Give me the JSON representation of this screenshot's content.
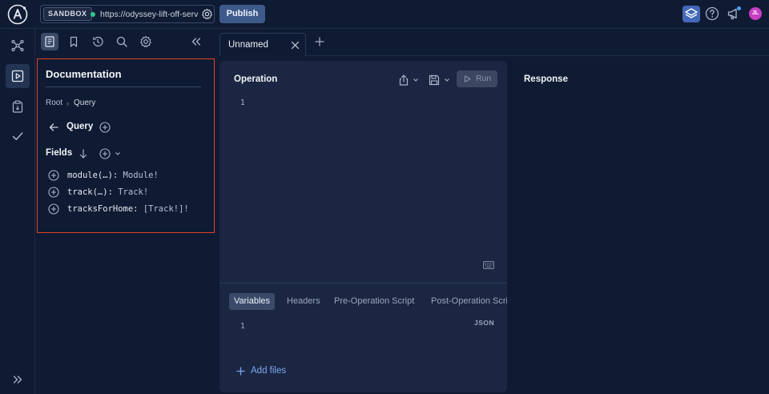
{
  "topbar": {
    "sandbox_badge": "SANDBOX",
    "endpoint_url": "https://odyssey-lift-off-server",
    "publish_label": "Publish",
    "avatar_initials": "JL",
    "status_color": "#34c48a",
    "accent_color": "#4368b8"
  },
  "rail": {
    "items": [
      "schema-graph-icon",
      "explorer-play-icon",
      "checks-list-icon",
      "checkmark-icon"
    ],
    "footer": "expand-icon"
  },
  "sidebar": {
    "toolbar_icons": [
      "documentation-icon",
      "bookmark-icon",
      "history-icon",
      "search-icon",
      "settings-icon",
      "collapse-icon"
    ]
  },
  "documentation": {
    "title": "Documentation",
    "breadcrumb": {
      "root": "Root",
      "separator": "›",
      "current": "Query"
    },
    "type_name": "Query",
    "fields_heading": "Fields",
    "fields": [
      {
        "name": "module(…):",
        "type": "Module!"
      },
      {
        "name": "track(…):",
        "type": "Track!"
      },
      {
        "name": "tracksForHome:",
        "type": "[Track!]!"
      }
    ]
  },
  "tabs": [
    {
      "label": "Unnamed"
    }
  ],
  "operation": {
    "title": "Operation",
    "run_label": "Run",
    "line_number": "1",
    "sub_tabs": {
      "variables": "Variables",
      "headers": "Headers",
      "pre_script": "Pre-Operation Script",
      "post_script": "Post-Operation Script"
    },
    "variables_line_number": "1",
    "json_label": "JSON",
    "add_files_label": "Add files"
  },
  "response": {
    "title": "Response"
  }
}
